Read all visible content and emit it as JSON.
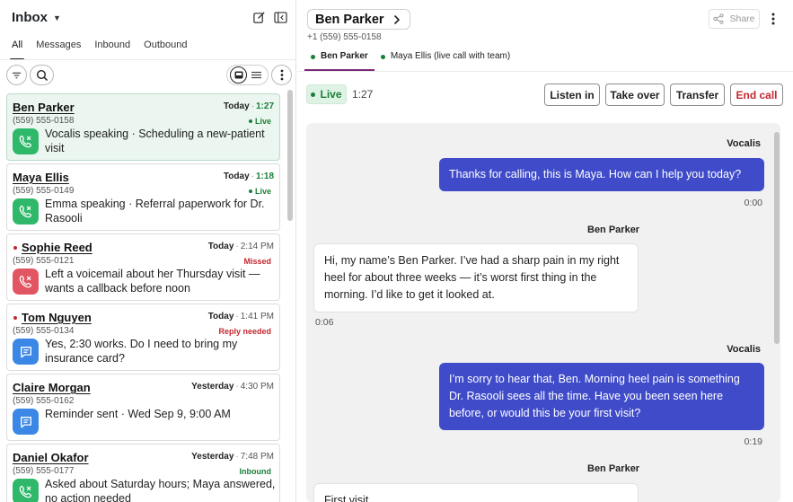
{
  "inbox": {
    "title": "Inbox",
    "tabs": [
      "All",
      "Messages",
      "Inbound",
      "Outbound"
    ],
    "active_tab": "All"
  },
  "conversations": [
    {
      "name": "Ben Parker",
      "phone": "(559) 555-0158",
      "day": "Today",
      "time": "1:27",
      "badge": "Live",
      "icon": "phone-missed-icon",
      "icon_color": "#2fb86a",
      "text": "Vocalis speaking · Scheduling a new-patient visit",
      "unread": false
    },
    {
      "name": "Maya Ellis",
      "phone": "(559) 555-0149",
      "day": "Today",
      "time": "1:18",
      "badge": "Live",
      "icon": "phone-missed-icon",
      "icon_color": "#2fb86a",
      "text": "Emma speaking · Referral paperwork for Dr. Rasooli",
      "unread": false
    },
    {
      "name": "Sophie Reed",
      "phone": "(559) 555-0121",
      "day": "Today",
      "time": "2:14 PM",
      "badge": "Missed",
      "icon": "phone-missed-icon",
      "icon_color": "#e25563",
      "text": "Left a voicemail about her Thursday visit — wants a callback before noon",
      "unread": true
    },
    {
      "name": "Tom Nguyen",
      "phone": "(559) 555-0134",
      "day": "Today",
      "time": "1:41 PM",
      "badge": "Reply needed",
      "icon": "message-icon",
      "icon_color": "#3b87e6",
      "text": "Yes, 2:30 works. Do I need to bring my insurance card?",
      "unread": true
    },
    {
      "name": "Claire Morgan",
      "phone": "(559) 555-0162",
      "day": "Yesterday",
      "time": "4:30 PM",
      "badge": "",
      "icon": "message-icon",
      "icon_color": "#3b87e6",
      "text": "Reminder sent · Wed Sep 9, 9:00 AM",
      "unread": false
    },
    {
      "name": "Daniel Okafor",
      "phone": "(559) 555-0177",
      "day": "Yesterday",
      "time": "7:48 PM",
      "badge": "Inbound",
      "icon": "phone-missed-icon",
      "icon_color": "#2fb86a",
      "text": "Asked about Saturday hours; Maya answered, no action needed",
      "unread": false
    }
  ],
  "detail": {
    "contact_name": "Ben Parker",
    "contact_phone": "+1 (559) 555-0158",
    "share_label": "Share",
    "participants": [
      "Ben Parker",
      "Maya Ellis (live call with team)"
    ],
    "status": "Live",
    "duration": "1:27",
    "actions": {
      "listen": "Listen in",
      "take_over": "Take over",
      "transfer": "Transfer",
      "end": "End call"
    }
  },
  "transcript": [
    {
      "speaker": "Vocalis",
      "side": "out",
      "text": "Thanks for calling, this is Maya. How can I help you today?",
      "time": "0:00"
    },
    {
      "speaker": "Ben Parker",
      "side": "in",
      "text": "Hi, my name’s Ben Parker. I’ve had a sharp pain in my right heel for about three weeks — it’s worst first thing in the morning. I’d like to get it looked at.",
      "time": "0:06"
    },
    {
      "speaker": "Vocalis",
      "side": "out",
      "text": "I’m sorry to hear that, Ben. Morning heel pain is something Dr. Rasooli sees all the time. Have you been seen here before, or would this be your first visit?",
      "time": "0:19"
    },
    {
      "speaker": "Ben Parker",
      "side": "in",
      "text": "First visit.",
      "time": ""
    }
  ],
  "colors": {
    "live_green": "#1a7f37",
    "agent_bubble": "#3f4bc9",
    "alert_red": "#c4272f",
    "active_tab_underline": "#7a2a78"
  }
}
